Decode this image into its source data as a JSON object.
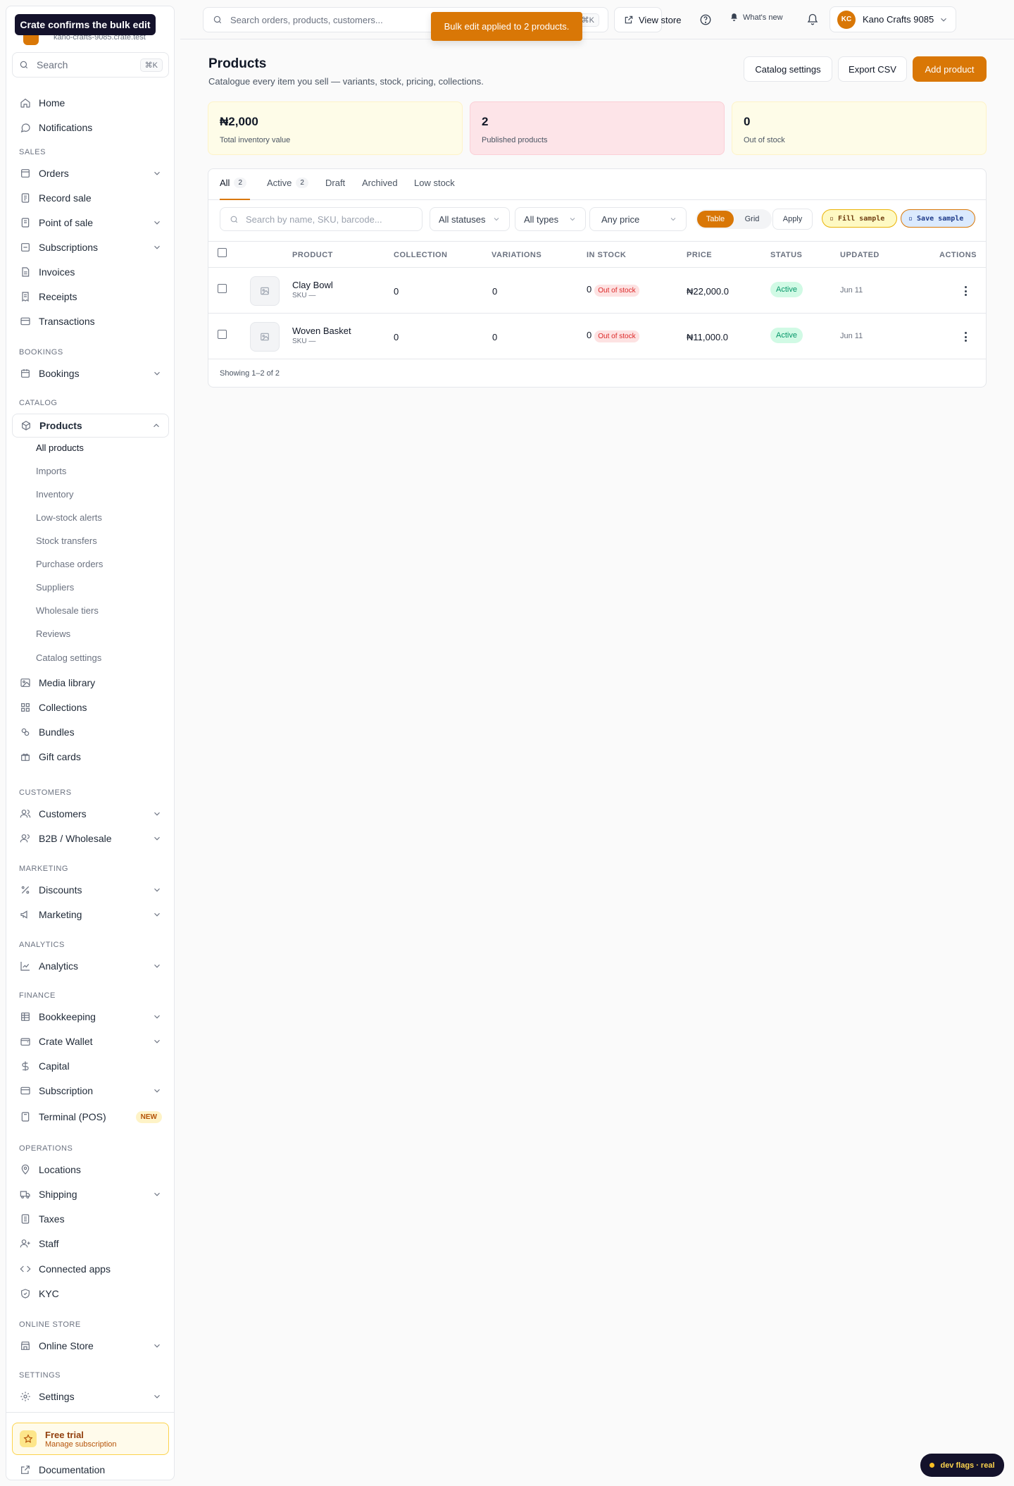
{
  "toast": "Crate confirms the bulk edit",
  "store_domain": "kano-crafts-9085.crate.test",
  "sidebar": {
    "search_placeholder": "Search",
    "search_kbd": "⌘K",
    "home": "Home",
    "notifications": "Notifications",
    "sections": {
      "sales": "SALES",
      "bookings": "BOOKINGS",
      "catalog": "CATALOG",
      "customers": "CUSTOMERS",
      "marketing": "MARKETING",
      "analytics": "ANALYTICS",
      "finance": "FINANCE",
      "operations": "OPERATIONS",
      "online_store": "ONLINE STORE",
      "settings": "SETTINGS"
    },
    "items": {
      "orders": "Orders",
      "record_sale": "Record sale",
      "pos": "Point of sale",
      "subscriptions": "Subscriptions",
      "invoices": "Invoices",
      "receipts": "Receipts",
      "transactions": "Transactions",
      "bookings": "Bookings",
      "products": "Products",
      "media": "Media library",
      "collections": "Collections",
      "bundles": "Bundles",
      "gift_cards": "Gift cards",
      "customers": "Customers",
      "b2b": "B2B / Wholesale",
      "discounts": "Discounts",
      "marketing": "Marketing",
      "analytics": "Analytics",
      "bookkeeping": "Bookkeeping",
      "wallet": "Crate Wallet",
      "capital": "Capital",
      "subscription": "Subscription",
      "terminal": "Terminal (POS)",
      "terminal_badge": "NEW",
      "locations": "Locations",
      "shipping": "Shipping",
      "taxes": "Taxes",
      "staff": "Staff",
      "connected": "Connected apps",
      "kyc": "KYC",
      "online_store": "Online Store",
      "settings": "Settings",
      "documentation": "Documentation"
    },
    "products_sub": [
      "All products",
      "Imports",
      "Inventory",
      "Low-stock alerts",
      "Stock transfers",
      "Purchase orders",
      "Suppliers",
      "Wholesale tiers",
      "Reviews",
      "Catalog settings"
    ],
    "trial": {
      "title": "Free trial",
      "subtitle": "Manage subscription"
    }
  },
  "topbar": {
    "search_placeholder": "Search orders, products, customers...",
    "search_kbd": "⌘K",
    "view_store": "View store",
    "whats_new": "What's new",
    "account_initials": "KC",
    "account_name": "Kano Crafts 9085"
  },
  "notice": "Bulk edit applied to 2 products.",
  "page": {
    "title": "Products",
    "subtitle": "Catalogue every item you sell — variants, stock, pricing, collections.",
    "catalog_settings": "Catalog settings",
    "export_csv": "Export CSV",
    "add_product": "Add product"
  },
  "stats": [
    {
      "value": "₦2,000",
      "label": "Total inventory value",
      "bg": "#fefce8",
      "border": "#fef3c7"
    },
    {
      "value": "2",
      "label": "Published products",
      "bg": "#fde4e8",
      "border": "#fbcfd6"
    },
    {
      "value": "0",
      "label": "Out of stock",
      "bg": "#fefce8",
      "border": "#fef3c7"
    }
  ],
  "tabs": [
    {
      "label": "All",
      "count": "2"
    },
    {
      "label": "Active",
      "count": "2"
    },
    {
      "label": "Draft"
    },
    {
      "label": "Archived"
    },
    {
      "label": "Low stock"
    }
  ],
  "filters": {
    "search_placeholder": "Search by name, SKU, barcode...",
    "status": "All statuses",
    "type": "All types",
    "price": "Any price",
    "view_table": "Table",
    "view_grid": "Grid",
    "apply": "Apply",
    "fill_sample": "▫ Fill sample",
    "save_sample": "▫ Save sample"
  },
  "columns": [
    "PRODUCT",
    "COLLECTION",
    "VARIATIONS",
    "IN STOCK",
    "PRICE",
    "STATUS",
    "UPDATED",
    "ACTIONS"
  ],
  "rows": [
    {
      "name": "Clay Bowl",
      "sku": "SKU —",
      "collection": "0",
      "variations": "0",
      "stock": "0",
      "stock_badge": "Out of stock",
      "price": "₦22,000.0",
      "status": "Active",
      "updated": "Jun 11"
    },
    {
      "name": "Woven Basket",
      "sku": "SKU —",
      "collection": "0",
      "variations": "0",
      "stock": "0",
      "stock_badge": "Out of stock",
      "price": "₦11,000.0",
      "status": "Active",
      "updated": "Jun 11"
    }
  ],
  "pagination": "Showing 1–2 of 2",
  "dev_flags": "dev flags · real",
  "colors": {
    "accent": "#d97706",
    "dark": "#14122b"
  }
}
